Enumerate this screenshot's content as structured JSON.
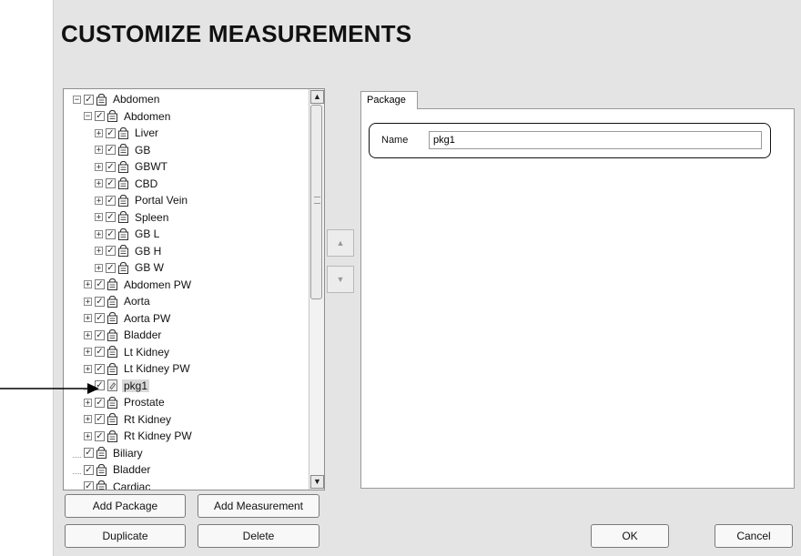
{
  "window": {
    "title": "CUSTOMIZE MEASUREMENTS"
  },
  "tree": {
    "items": [
      {
        "label": "Abdomen",
        "depth": 0,
        "expander": "minus",
        "icon": "report-lock-icon",
        "checked": true,
        "selected": false
      },
      {
        "label": "Abdomen",
        "depth": 1,
        "expander": "minus",
        "icon": "report-lock-icon",
        "checked": true,
        "selected": false
      },
      {
        "label": "Liver",
        "depth": 2,
        "expander": "plus",
        "icon": "report-lock-icon",
        "checked": true,
        "selected": false
      },
      {
        "label": "GB",
        "depth": 2,
        "expander": "plus",
        "icon": "report-lock-icon",
        "checked": true,
        "selected": false
      },
      {
        "label": "GBWT",
        "depth": 2,
        "expander": "plus",
        "icon": "report-lock-icon",
        "checked": true,
        "selected": false
      },
      {
        "label": "CBD",
        "depth": 2,
        "expander": "plus",
        "icon": "report-lock-icon",
        "checked": true,
        "selected": false
      },
      {
        "label": "Portal Vein",
        "depth": 2,
        "expander": "plus",
        "icon": "report-lock-icon",
        "checked": true,
        "selected": false
      },
      {
        "label": "Spleen",
        "depth": 2,
        "expander": "plus",
        "icon": "report-lock-icon",
        "checked": true,
        "selected": false
      },
      {
        "label": "GB L",
        "depth": 2,
        "expander": "plus",
        "icon": "report-lock-icon",
        "checked": true,
        "selected": false
      },
      {
        "label": "GB H",
        "depth": 2,
        "expander": "plus",
        "icon": "report-lock-icon",
        "checked": true,
        "selected": false
      },
      {
        "label": "GB W",
        "depth": 2,
        "expander": "plus",
        "icon": "report-lock-icon",
        "checked": true,
        "selected": false
      },
      {
        "label": "Abdomen PW",
        "depth": 1,
        "expander": "plus",
        "icon": "report-lock-icon",
        "checked": true,
        "selected": false
      },
      {
        "label": "Aorta",
        "depth": 1,
        "expander": "plus",
        "icon": "report-lock-icon",
        "checked": true,
        "selected": false
      },
      {
        "label": "Aorta PW",
        "depth": 1,
        "expander": "plus",
        "icon": "report-lock-icon",
        "checked": true,
        "selected": false
      },
      {
        "label": "Bladder",
        "depth": 1,
        "expander": "plus",
        "icon": "report-lock-icon",
        "checked": true,
        "selected": false
      },
      {
        "label": "Lt Kidney",
        "depth": 1,
        "expander": "plus",
        "icon": "report-lock-icon",
        "checked": true,
        "selected": false
      },
      {
        "label": "Lt Kidney PW",
        "depth": 1,
        "expander": "plus",
        "icon": "report-lock-icon",
        "checked": true,
        "selected": false
      },
      {
        "label": "pkg1",
        "depth": 1,
        "expander": "none",
        "icon": "package-edit-icon",
        "checked": true,
        "selected": true
      },
      {
        "label": "Prostate",
        "depth": 1,
        "expander": "plus",
        "icon": "report-lock-icon",
        "checked": true,
        "selected": false
      },
      {
        "label": "Rt Kidney",
        "depth": 1,
        "expander": "plus",
        "icon": "report-lock-icon",
        "checked": true,
        "selected": false
      },
      {
        "label": "Rt Kidney PW",
        "depth": 1,
        "expander": "plus",
        "icon": "report-lock-icon",
        "checked": true,
        "selected": false
      },
      {
        "label": "Biliary",
        "depth": 0,
        "expander": "none",
        "icon": "report-lock-icon",
        "checked": true,
        "selected": false
      },
      {
        "label": "Bladder",
        "depth": 0,
        "expander": "none",
        "icon": "report-lock-icon",
        "checked": true,
        "selected": false
      },
      {
        "label": "Cardiac",
        "depth": 0,
        "expander": "none",
        "icon": "report-lock-icon",
        "checked": true,
        "selected": false
      }
    ],
    "scroll_up_glyph": "▲",
    "scroll_down_glyph": "▼"
  },
  "move": {
    "up_glyph": "▲",
    "down_glyph": "▼"
  },
  "package_panel": {
    "tab_label": "Package",
    "name_label": "Name",
    "name_value": "pkg1"
  },
  "buttons": {
    "add_package": "Add Package",
    "add_measurement": "Add Measurement",
    "duplicate": "Duplicate",
    "delete": "Delete",
    "ok": "OK",
    "cancel": "Cancel"
  },
  "annotation": {
    "arrow_target": "pkg1"
  },
  "colors": {
    "window_bg": "#e4e4e4",
    "selection_bg": "#d9d9d9",
    "outline": "#111111"
  }
}
